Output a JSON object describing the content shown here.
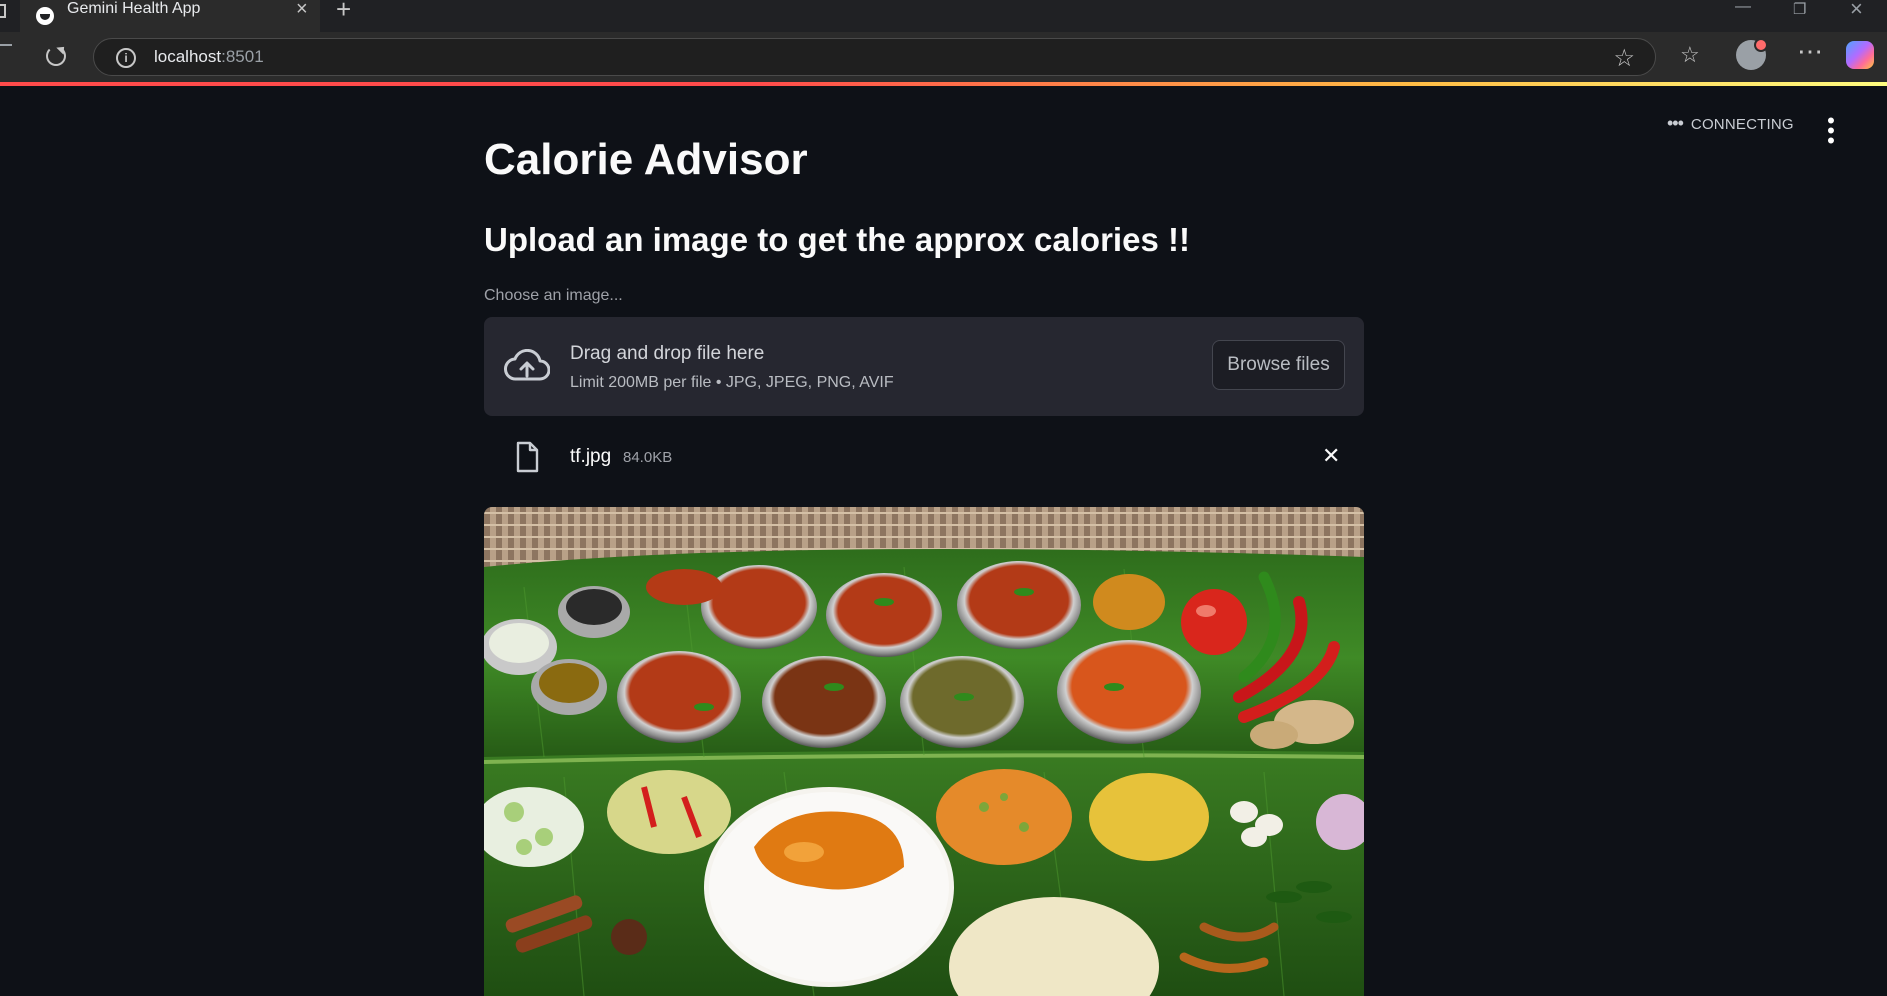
{
  "browser": {
    "tab_title": "Gemini Health App",
    "url_host": "localhost",
    "url_port": ":8501"
  },
  "app": {
    "status": "CONNECTING",
    "title": "Calorie Advisor",
    "subheader": "Upload an image to get the approx calories !!",
    "uploader": {
      "label": "Choose an image...",
      "drop_text": "Drag and drop file here",
      "limit_text": "Limit 200MB per file • JPG, JPEG, PNG, AVIF",
      "browse_label": "Browse files"
    },
    "file": {
      "name": "tf.jpg",
      "size": "84.0KB"
    }
  },
  "colors": {
    "background": "#0e1117",
    "dropzone": "#262730",
    "accent": "#ff4b4b"
  }
}
